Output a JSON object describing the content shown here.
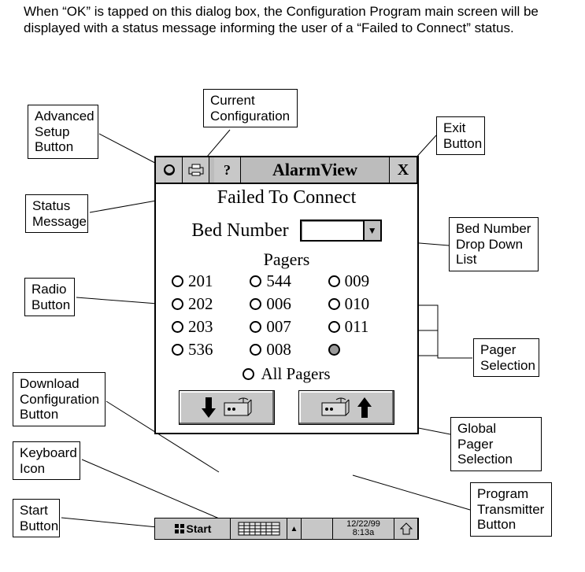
{
  "intro_text": "When “OK” is tapped on this dialog box, the Configuration Program main screen will be displayed with a status message informing the user of a “Failed to Connect” status.",
  "titlebar": {
    "app_name": "AlarmView",
    "exit_glyph": "X"
  },
  "status_message": "Failed To Connect",
  "bed": {
    "label": "Bed Number",
    "value": ""
  },
  "pagers": {
    "heading": "Pagers",
    "col1": [
      "201",
      "202",
      "203",
      "536"
    ],
    "col2": [
      "544",
      "006",
      "007",
      "008"
    ],
    "col3": [
      "009",
      "010",
      "011",
      ""
    ],
    "all_label": "All Pagers"
  },
  "taskbar": {
    "start_label": "Start",
    "date": "12/22/99",
    "time": "8:13a"
  },
  "callouts": {
    "adv_setup": "Advanced\nSetup\nButton",
    "current_cfg": "Current\nConfiguration",
    "exit_btn": "Exit\nButton",
    "status_msg": "Status\nMessage",
    "bed_dd": "Bed Number\nDrop Down\nList",
    "radio_btn": "Radio\nButton",
    "pager_sel": "Pager\nSelection",
    "download_cfg": "Download\nConfiguration\nButton",
    "global_pager": "Global Pager\nSelection",
    "kbd_icon": "Keyboard\nIcon",
    "program_tx": "Program\nTransmitter\nButton",
    "start_btn": "Start\nButton"
  }
}
